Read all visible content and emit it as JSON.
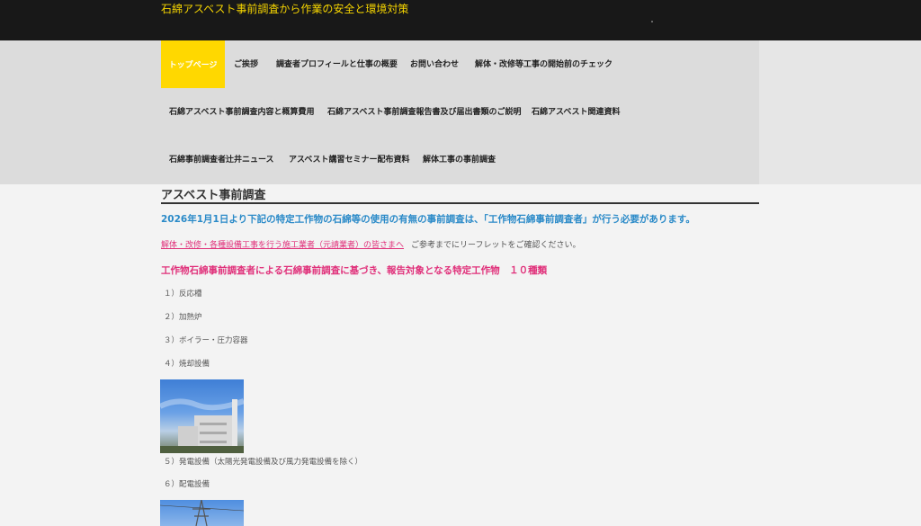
{
  "header": {
    "site_title": "石綿アスベスト事前調査から作業の安全と環境対策"
  },
  "nav": {
    "active": "トップページ",
    "row1": [
      "ご挨拶",
      "調査者プロフィールと仕事の概要",
      "お問い合わせ",
      "解体・改修等工事の開始前のチェック"
    ],
    "row2": [
      "石綿アスベスト事前調査内容と概算費用",
      "石綿アスベスト事前調査報告書及び届出書類のご説明",
      "石綿アスベスト関連資料"
    ],
    "row3": [
      "石綿事前調査者辻井ニュース",
      "アスベスト講習セミナー配布資料",
      "解体工事の事前調査"
    ]
  },
  "main": {
    "page_title": "アスベスト事前調査",
    "notice": "2026年1月1日より下記の特定工作物の石綿等の使用の有無の事前調査は、「工作物石綿事前調査者」が行う必要があります。",
    "link_text": "解体・改修・各種設備工事を行う施工業者（元請業者）の皆さまへ",
    "link_note": "ご参考までにリーフレットをご確認ください。",
    "subhead": "工作物石綿事前調査者による石綿事前調査に基づき、報告対象となる特定工作物　１０種類",
    "items": [
      "１）反応槽",
      "２）加熱炉",
      "３）ボイラー・圧力容器",
      "４）焼却設備",
      "５）発電設備（太陽光発電設備及び風力発電設備を除く）",
      "６）配電設備"
    ]
  },
  "colors": {
    "accent_yellow": "#ffd800",
    "notice_blue": "#2a8ac8",
    "link_pink": "#e0307a"
  }
}
